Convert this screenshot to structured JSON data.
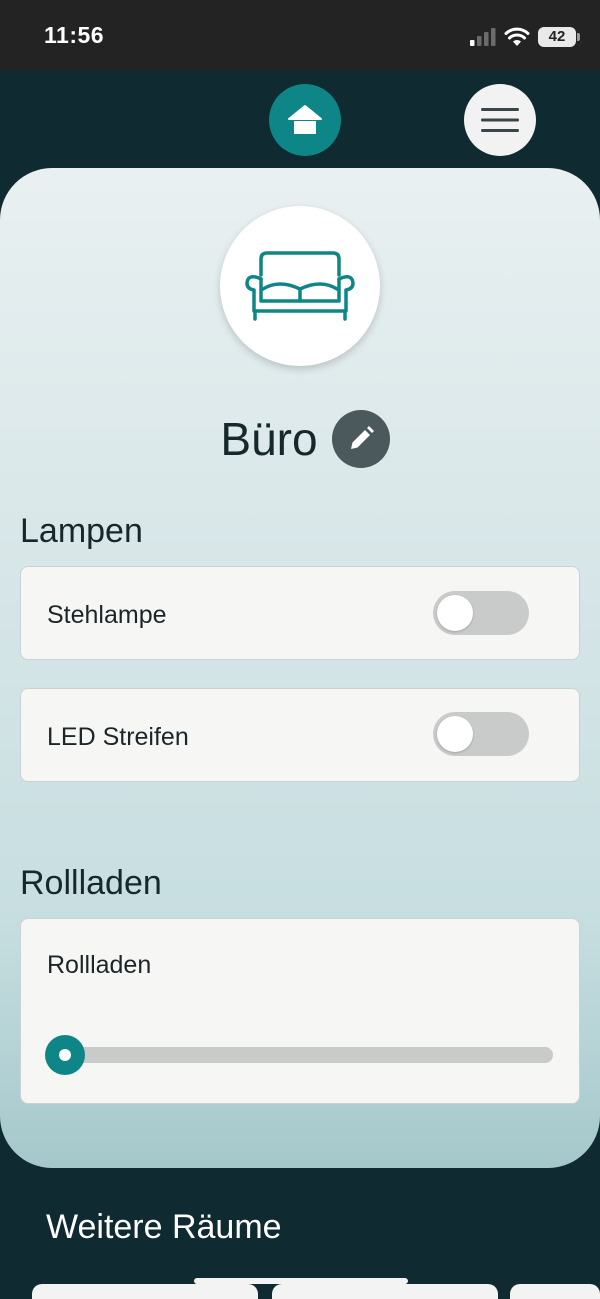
{
  "status_bar": {
    "time": "11:56",
    "battery": "42",
    "icons": [
      "signal-icon",
      "wifi-icon",
      "battery-icon"
    ]
  },
  "nav": {
    "home_icon": "home-icon",
    "menu_icon": "hamburger-menu-icon",
    "accent": "#0e8586"
  },
  "room": {
    "icon": "sofa-icon",
    "name": "Büro",
    "edit_icon": "pencil-icon"
  },
  "lamps": {
    "heading": "Lampen",
    "items": [
      {
        "label": "Stehlampe",
        "on": false
      },
      {
        "label": "LED Streifen",
        "on": false
      }
    ]
  },
  "shutters": {
    "heading": "Rollladen",
    "items": [
      {
        "label": "Rollladen",
        "position_percent": 0
      }
    ]
  },
  "more_rooms": {
    "heading": "Weitere Räume"
  }
}
